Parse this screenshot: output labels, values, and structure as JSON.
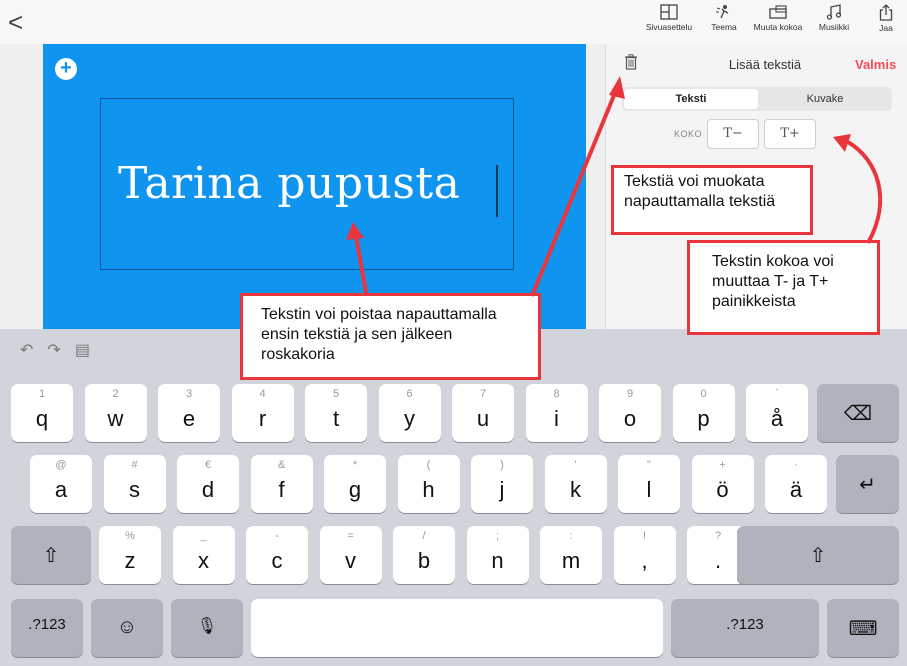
{
  "nav": {
    "back_symbol": "<",
    "tools": [
      {
        "label": "Sivuasettelu",
        "icon": "layout-icon"
      },
      {
        "label": "Teema",
        "icon": "theme-icon"
      },
      {
        "label": "Muuta kokoa",
        "icon": "resize-icon"
      },
      {
        "label": "Musiikki",
        "icon": "music-icon"
      },
      {
        "label": "Jaa",
        "icon": "share-icon"
      }
    ]
  },
  "slide": {
    "title": "Tarina pupusta",
    "color": "#0f95f0"
  },
  "panel": {
    "title": "Lisää tekstiä",
    "done": "Valmis",
    "tabs": [
      "Teksti",
      "Kuvake"
    ],
    "size_label": "KOKO",
    "size_minus": "T−",
    "size_plus": "T+"
  },
  "callouts": {
    "edit_text": "Tekstiä voi muokata napauttamalla tekstiä",
    "size_text": "Tekstin kokoa voi muuttaa T- ja T+ painikkeista",
    "delete_text": "Tekstin voi poistaa napauttamalla ensin tekstiä ja sen jälkeen roskakoria"
  },
  "keyboard": {
    "row1": [
      {
        "main": "q",
        "alt": "1"
      },
      {
        "main": "w",
        "alt": "2"
      },
      {
        "main": "e",
        "alt": "3"
      },
      {
        "main": "r",
        "alt": "4"
      },
      {
        "main": "t",
        "alt": "5"
      },
      {
        "main": "y",
        "alt": "6"
      },
      {
        "main": "u",
        "alt": "7"
      },
      {
        "main": "i",
        "alt": "8"
      },
      {
        "main": "o",
        "alt": "9"
      },
      {
        "main": "p",
        "alt": "0"
      },
      {
        "main": "å",
        "alt": "`"
      }
    ],
    "row2": [
      {
        "main": "a",
        "alt": "@"
      },
      {
        "main": "s",
        "alt": "#"
      },
      {
        "main": "d",
        "alt": "€"
      },
      {
        "main": "f",
        "alt": "&"
      },
      {
        "main": "g",
        "alt": "*"
      },
      {
        "main": "h",
        "alt": "("
      },
      {
        "main": "j",
        "alt": ")"
      },
      {
        "main": "k",
        "alt": "'"
      },
      {
        "main": "l",
        "alt": "\""
      },
      {
        "main": "ö",
        "alt": "+"
      },
      {
        "main": "ä",
        "alt": "·"
      }
    ],
    "row3": [
      {
        "main": "z",
        "alt": "%"
      },
      {
        "main": "x",
        "alt": "_"
      },
      {
        "main": "c",
        "alt": "-"
      },
      {
        "main": "v",
        "alt": "="
      },
      {
        "main": "b",
        "alt": "/"
      },
      {
        "main": "n",
        "alt": ";"
      },
      {
        "main": "m",
        "alt": ":"
      },
      {
        "main": ",",
        "alt": "!"
      },
      {
        "main": ".",
        "alt": "?"
      }
    ],
    "numbers_label": ".?123",
    "backspace_symbol": "⌫",
    "return_symbol": "↵",
    "shift_symbol": "⇧",
    "emoji_symbol": "☺",
    "mic_symbol": "🎙",
    "hide_symbol": "⌨"
  }
}
